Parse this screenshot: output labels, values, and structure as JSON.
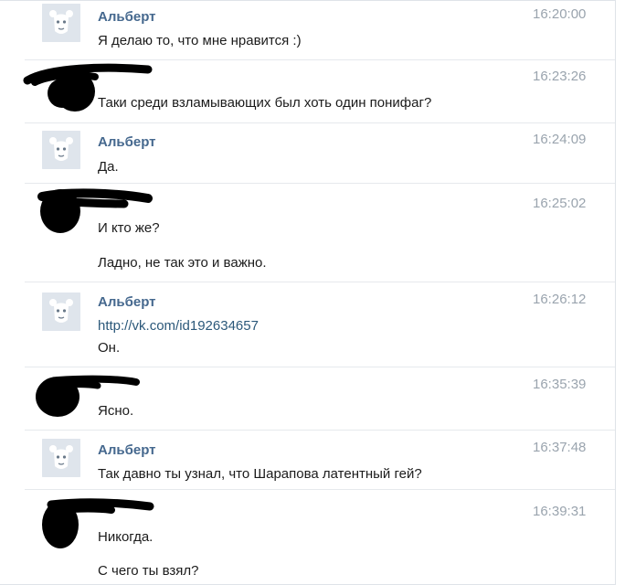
{
  "messages": [
    {
      "author": "Альберт",
      "time": "16:20:00",
      "lines": [
        "Я делаю то, что мне нравится :)"
      ]
    },
    {
      "author": "",
      "time": "16:23:26",
      "lines": [
        "Таки среди взламывающих был хоть один понифаг?"
      ]
    },
    {
      "author": "Альберт",
      "time": "16:24:09",
      "lines": [
        "Да."
      ]
    },
    {
      "author": "",
      "time": "16:25:02",
      "lines": [
        "И кто же?",
        "Ладно, не так это и важно."
      ]
    },
    {
      "author": "Альберт",
      "time": "16:26:12",
      "link": "http://vk.com/id192634657",
      "lines": [
        "Он."
      ]
    },
    {
      "author": "",
      "time": "16:35:39",
      "lines": [
        "Ясно."
      ]
    },
    {
      "author": "Альберт",
      "time": "16:37:48",
      "lines": [
        "Так давно ты узнал, что Шарапова латентный гей?"
      ]
    },
    {
      "author": "",
      "time": "16:39:31",
      "lines": [
        "Никогда.",
        "С чего ты взял?"
      ]
    }
  ],
  "colors": {
    "author_name": "#45688e",
    "link": "#2b587a",
    "time": "#9aa4ae",
    "text": "#1b1b1b",
    "scribble": "#000000",
    "avatar_bg": "#dfe5ec"
  },
  "icons": {
    "avatar": "default-avatar-icon",
    "redaction": "black-scribble"
  }
}
